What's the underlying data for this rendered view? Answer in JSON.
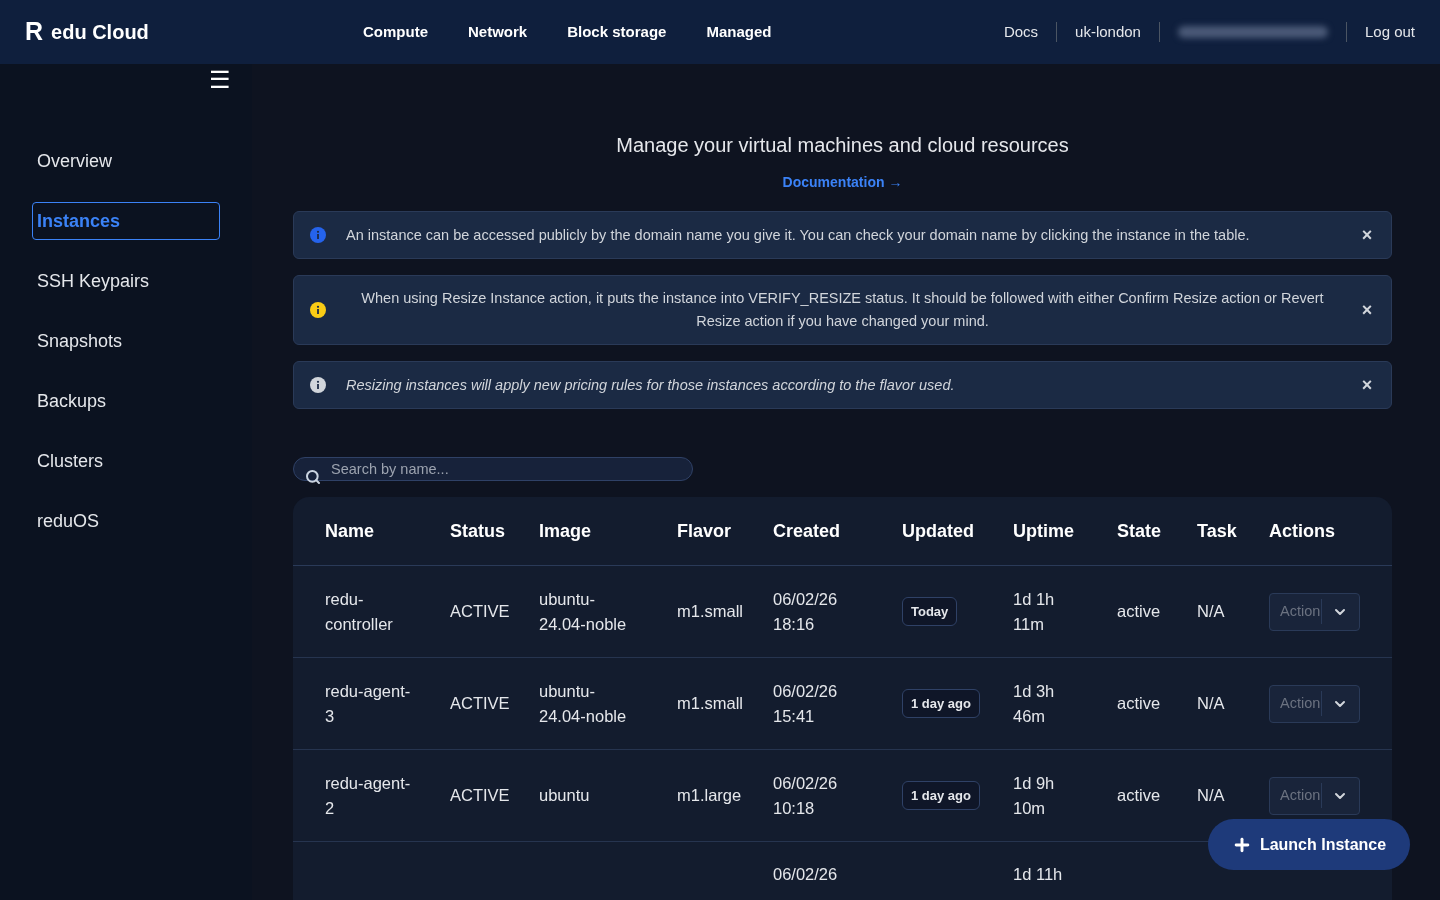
{
  "brand": {
    "mark": "R",
    "name": "edu Cloud"
  },
  "nav": [
    "Compute",
    "Network",
    "Block storage",
    "Managed"
  ],
  "header_links": [
    {
      "kind": "link",
      "label": "Docs"
    },
    {
      "kind": "link",
      "label": "uk-london"
    },
    {
      "kind": "blurred"
    },
    {
      "kind": "link",
      "label": "Log out"
    }
  ],
  "sidebar": {
    "menu_icon": "☰",
    "items": [
      {
        "label": "Overview",
        "selected": false
      },
      {
        "label": "Instances",
        "selected": true
      },
      {
        "label": "SSH Keypairs",
        "selected": false
      },
      {
        "label": "Snapshots",
        "selected": false
      },
      {
        "label": "Backups",
        "selected": false
      },
      {
        "label": "Clusters",
        "selected": false
      },
      {
        "label": "reduOS",
        "selected": false
      }
    ]
  },
  "page": {
    "title": "Manage your virtual machines and cloud resources",
    "doc_link": "Documentation →"
  },
  "alerts": [
    {
      "kind": "info",
      "text": "An instance can be accessed publicly by the domain name you give it. You can check your domain name by clicking the instance in the table.",
      "close": "×"
    },
    {
      "kind": "warning",
      "text": "When using Resize Instance action, it puts the instance into VERIFY_RESIZE status. It should be followed with either Confirm Resize action or Revert Resize action if you have changed your mind.",
      "close": "×"
    },
    {
      "kind": "note",
      "text": "Resizing instances will apply new pricing rules for those instances according to the flavor used.",
      "close": "×"
    }
  ],
  "search": {
    "placeholder": "Search by name..."
  },
  "table": {
    "columns": [
      "Name",
      "Status",
      "Image",
      "Flavor",
      "Created",
      "Updated",
      "Uptime",
      "State",
      "Task",
      "Actions"
    ],
    "rows": [
      {
        "name": "redu-controller",
        "status": "ACTIVE",
        "image": "ubuntu-24.04-noble",
        "flavor": "m1.small",
        "created": "06/02/26 18:16",
        "updated": "Today",
        "uptime": "1d 1h 11m",
        "state": "active",
        "task": "N/A",
        "action": "Action"
      },
      {
        "name": "redu-agent-3",
        "status": "ACTIVE",
        "image": "ubuntu-24.04-noble",
        "flavor": "m1.small",
        "created": "06/02/26 15:41",
        "updated": "1 day ago",
        "uptime": "1d 3h 46m",
        "state": "active",
        "task": "N/A",
        "action": "Action"
      },
      {
        "name": "redu-agent-2",
        "status": "ACTIVE",
        "image": "ubuntu",
        "flavor": "m1.large",
        "created": "06/02/26 10:18",
        "updated": "1 day ago",
        "uptime": "1d 9h 10m",
        "state": "active",
        "task": "N/A",
        "action": "Action"
      },
      {
        "created": "06/02/26",
        "uptime": "1d 11h"
      }
    ]
  },
  "fab": {
    "label": "Launch Instance"
  }
}
